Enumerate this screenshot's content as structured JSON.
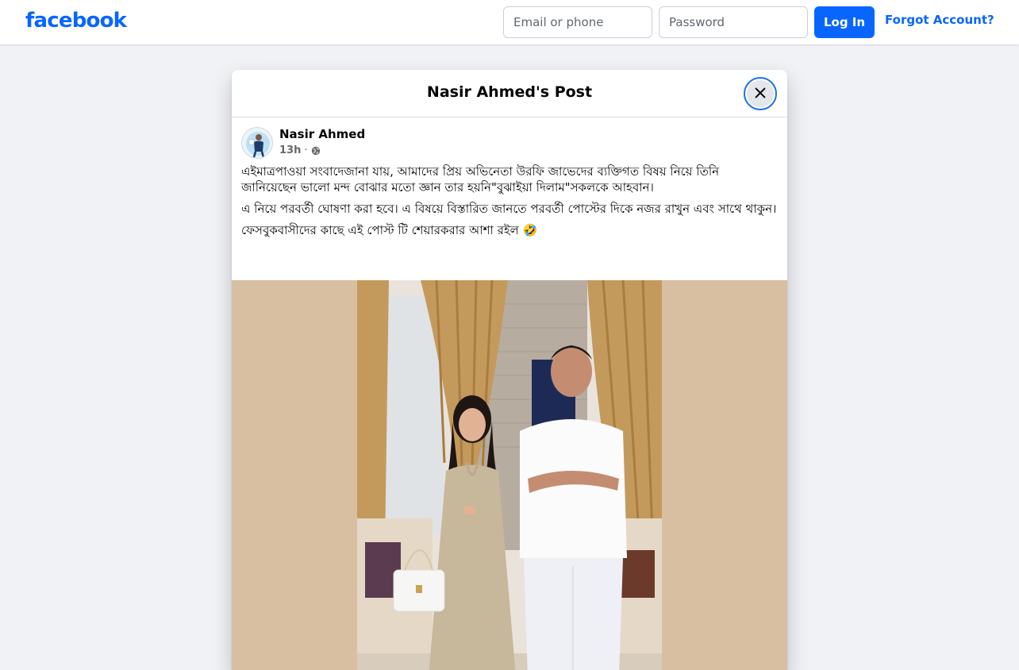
{
  "topbar": {
    "logo_text": "facebook",
    "email_placeholder": "Email or phone",
    "password_placeholder": "Password",
    "login_label": "Log In",
    "forgot_label": "Forgot Account?"
  },
  "modal": {
    "title": "Nasir Ahmed's Post",
    "close_icon": "close-icon"
  },
  "post": {
    "author": "Nasir Ahmed",
    "time": "13h",
    "separator": "·",
    "privacy_icon": "globe-icon",
    "paragraphs": [
      "এইমাত্রপাওয়া সংবাদে⁠জানা যায়, আমাদের প্রিয় অভিনেতা উরফি জাভেদের ব্যক্তিগত বিষয় নিয়ে তিনি জানিয়েছেন ভালো মন্দ বোঝার মতো জ্ঞান তার হয়নি\"বুঝাইয়া দিলাম\"সকলকে আহবান।",
      "এ নিয়ে পরবর্তী ঘোষণা করা হবে। এ বিষয়ে বিস্তারিত জানতে পরবর্তী পোস্টের দিকে নজর রাখুন এবং সাথে থাকুন।",
      "ফেসবুকবাসীদের কাছে এই পোস্ট টি শেয়ারকরার আশা রইল 🤣"
    ]
  },
  "colors": {
    "brand_blue": "#0866ff",
    "page_bg": "#f0f2f5",
    "photo_backdrop": "#d8bfa2"
  }
}
